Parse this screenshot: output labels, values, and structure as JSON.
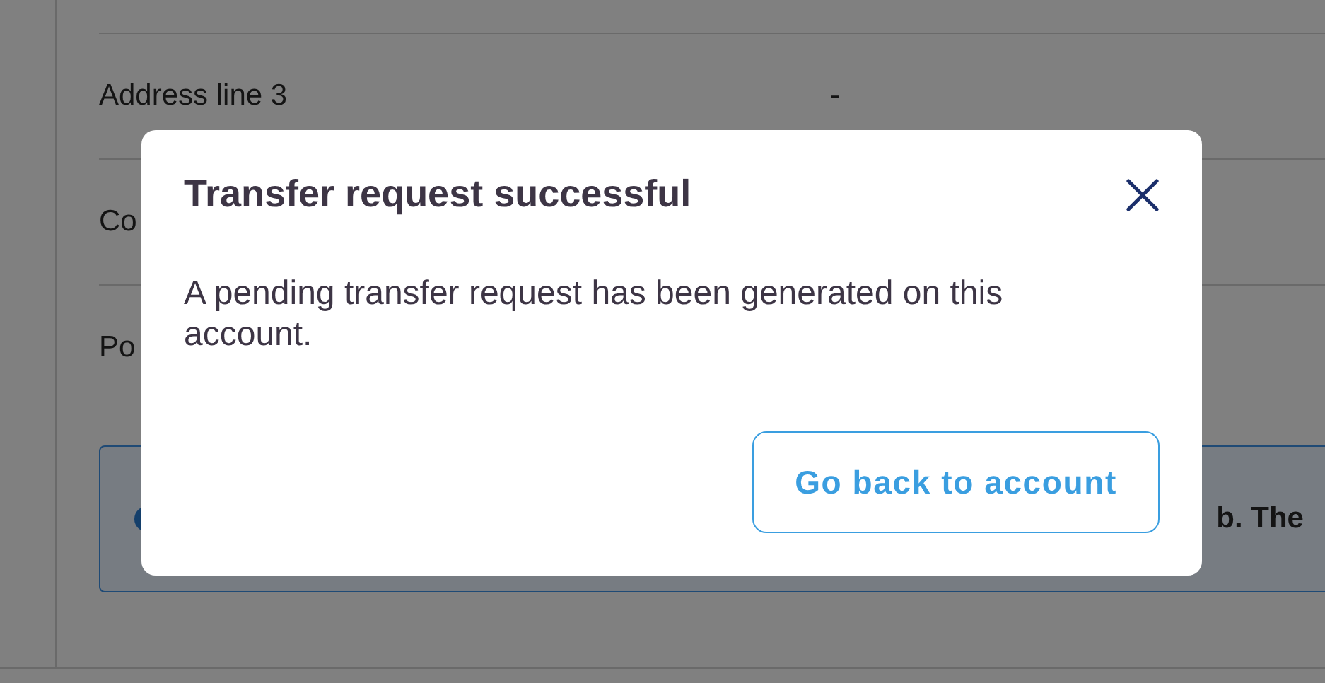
{
  "page": {
    "rows": [
      {
        "label": "Address line 3",
        "value": "-"
      },
      {
        "label": "Co",
        "value": ""
      },
      {
        "label": "Po",
        "value": ""
      }
    ],
    "banner": {
      "text": "b. The"
    }
  },
  "dialog": {
    "title": "Transfer request successful",
    "message": "A pending transfer request has been generated on this account.",
    "button": "Go back to account"
  }
}
